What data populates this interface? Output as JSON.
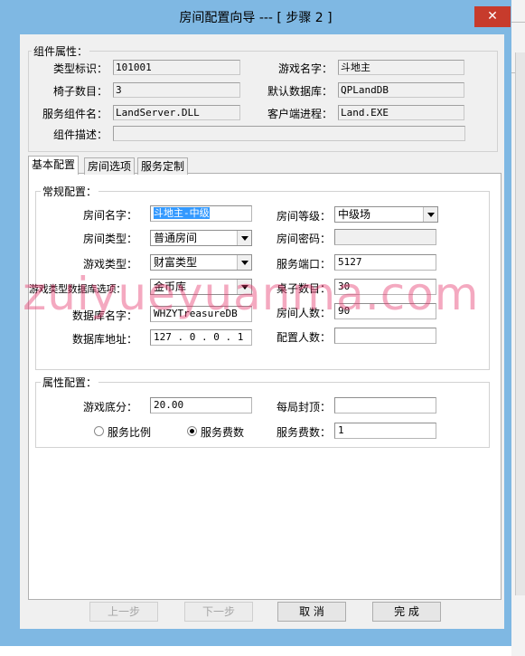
{
  "window": {
    "title": "房间配置向导 --- [ 步骤 2 ]",
    "close_glyph": "✕"
  },
  "component": {
    "legend": "组件属性：",
    "type_label": "类型标识：",
    "type_value": "101001",
    "game_label": "游戏名字：",
    "game_value": "斗地主",
    "chairs_label": "椅子数目：",
    "chairs_value": "3",
    "db_label": "默认数据库：",
    "db_value": "QPLandDB",
    "service_label": "服务组件名：",
    "service_value": "LandServer.DLL",
    "client_label": "客户端进程：",
    "client_value": "Land.EXE",
    "desc_label": "组件描述：",
    "desc_value": ""
  },
  "tabs": [
    {
      "label": "基本配置"
    },
    {
      "label": "房间选项"
    },
    {
      "label": "服务定制"
    }
  ],
  "general": {
    "legend": "常规配置：",
    "room_name_label": "房间名字：",
    "room_name_value": "斗地主-中级",
    "room_level_label": "房间等级：",
    "room_level_value": "中级场",
    "room_type_label": "房间类型：",
    "room_type_value": "普通房间",
    "room_password_label": "房间密码：",
    "room_password_value": "",
    "game_type_label": "游戏类型：",
    "game_type_value": "财富类型",
    "port_label": "服务端口：",
    "port_value": "5127",
    "db_select_label": "游戏类型数据库选项：",
    "db_select_value": "金币库",
    "tables_label": "桌子数目：",
    "tables_value": "30",
    "db_name_label": "数据库名字：",
    "db_name_value": "WHZYTreasureDB",
    "room_people_label": "房间人数：",
    "room_people_value": "90",
    "db_address_label": "数据库地址：",
    "db_address_value": "127 . 0 . 0 . 1",
    "config_people_label": "配置人数：",
    "config_people_value": ""
  },
  "attributes": {
    "legend": "属性配置：",
    "base_score_label": "游戏底分：",
    "base_score_value": "20.00",
    "lock_label": "每局封顶：",
    "lock_value": "",
    "ratio_label": "服务比例",
    "fee_radio_label": "服务费数",
    "fee_label": "服务费数：",
    "fee_value": "1",
    "selected_radio": "服务费数"
  },
  "buttons": {
    "prev": "上一步",
    "next": "下一步",
    "cancel": "取 消",
    "finish": "完 成"
  },
  "watermark": "zuiyueyuanma.com",
  "colors": {
    "frame": "#7fb8e3",
    "close": "#c73b2c",
    "selection": "#3399ff",
    "watermark": "#e43268"
  }
}
